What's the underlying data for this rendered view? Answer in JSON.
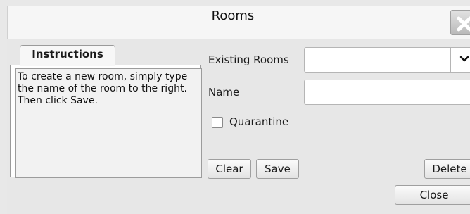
{
  "window": {
    "title": "Rooms",
    "close_icon": "close-x-icon"
  },
  "instructions": {
    "tab_label": "Instructions",
    "text": "To create a new room, simply type the name of the room to the right. Then click Save."
  },
  "form": {
    "existing_rooms_label": "Existing Rooms",
    "existing_rooms_value": "",
    "dropdown_icon": "chevron-down-icon",
    "name_label": "Name",
    "name_value": "",
    "quarantine_label": "Quarantine",
    "quarantine_checked": false
  },
  "buttons": {
    "clear": "Clear",
    "save": "Save",
    "delete": "Delete",
    "close": "Close"
  }
}
